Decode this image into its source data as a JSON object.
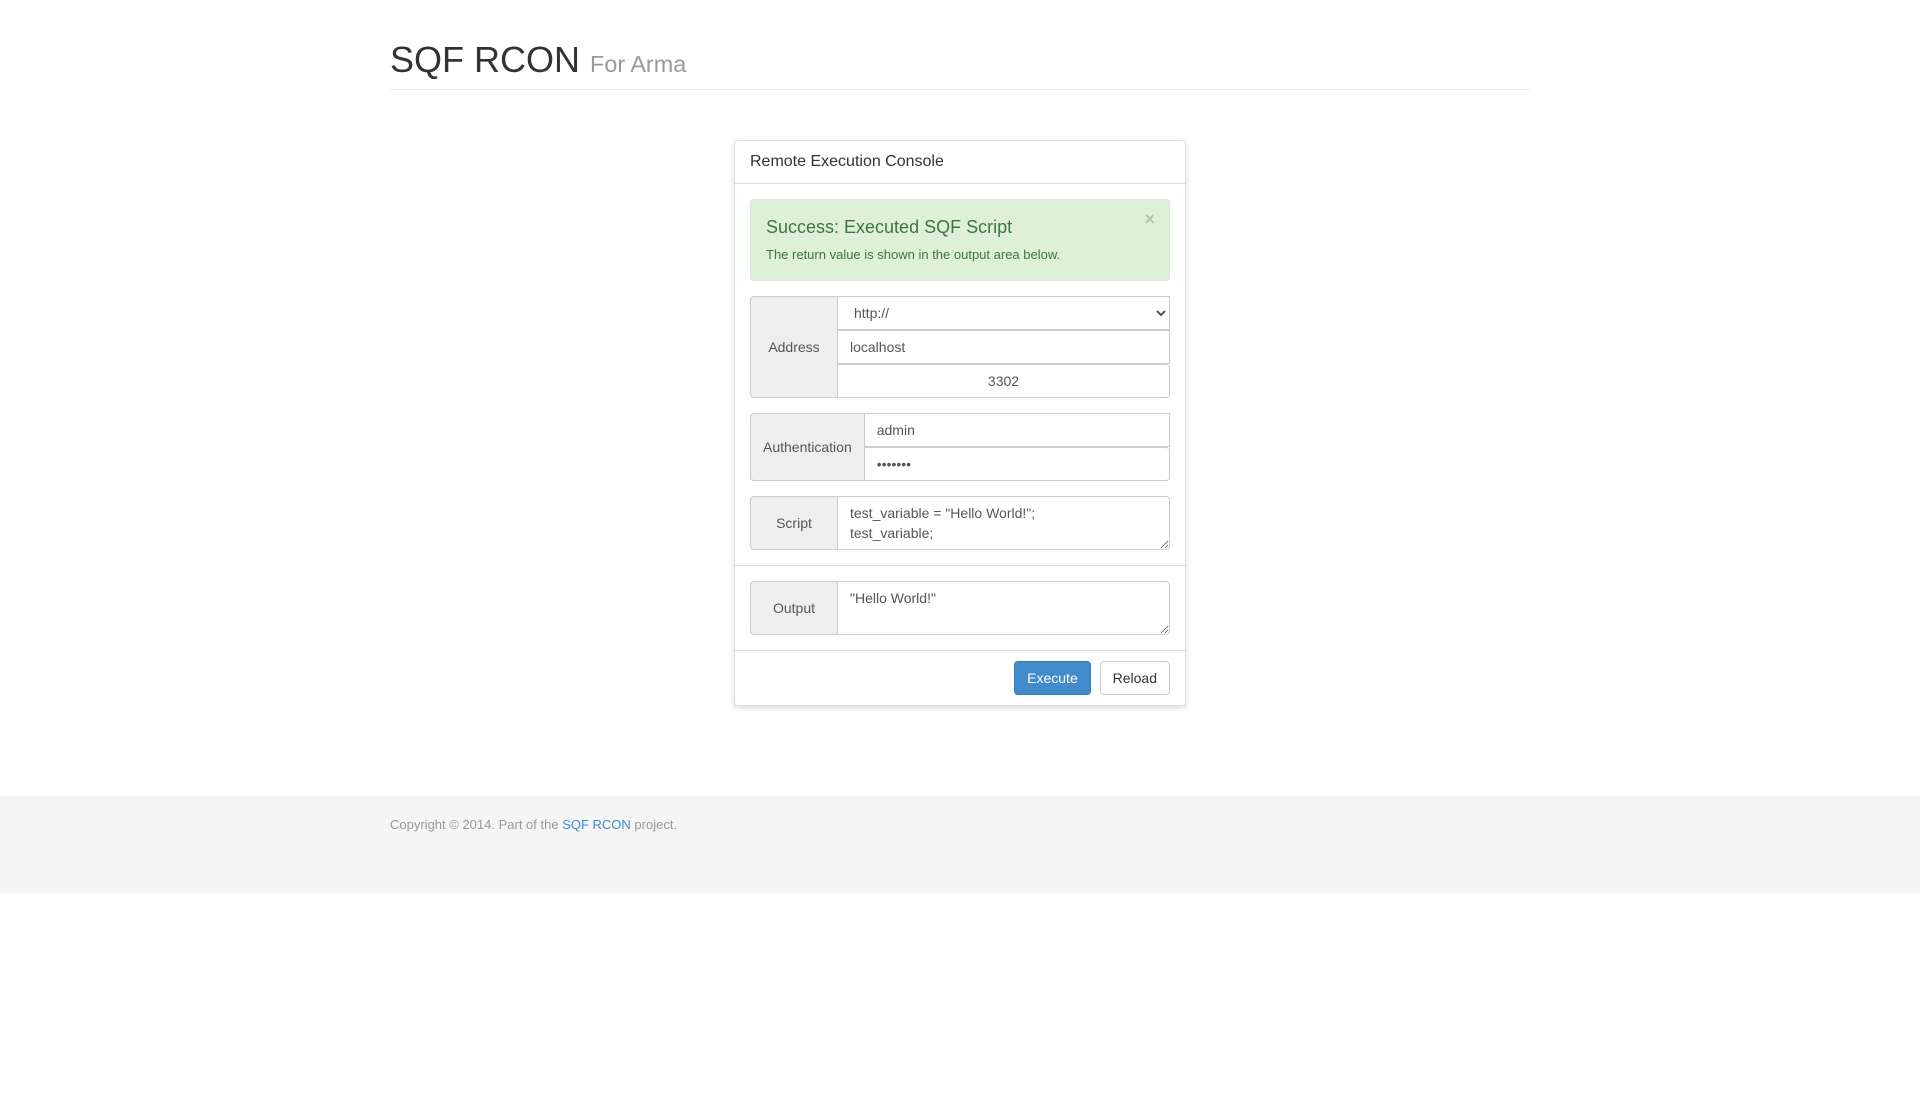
{
  "header": {
    "title": "SQF RCON",
    "subtitle": "For Arma"
  },
  "panel": {
    "title": "Remote Execution Console"
  },
  "alert": {
    "heading": "Success: Executed SQF Script",
    "body": "The return value is shown in the output area below.",
    "close_glyph": "×"
  },
  "address": {
    "label": "Address",
    "protocol": "http://",
    "host": "localhost",
    "port": "3302"
  },
  "auth": {
    "label": "Authentication",
    "user": "admin",
    "password": "•••••••"
  },
  "script": {
    "label": "Script",
    "value": "test_variable = \"Hello World!\";\ntest_variable;"
  },
  "output": {
    "label": "Output",
    "value": "\"Hello World!\""
  },
  "buttons": {
    "execute": "Execute",
    "reload": "Reload"
  },
  "footer": {
    "prefix": "Copyright © 2014. Part of the ",
    "link_text": "SQF RCON",
    "suffix": " project."
  }
}
